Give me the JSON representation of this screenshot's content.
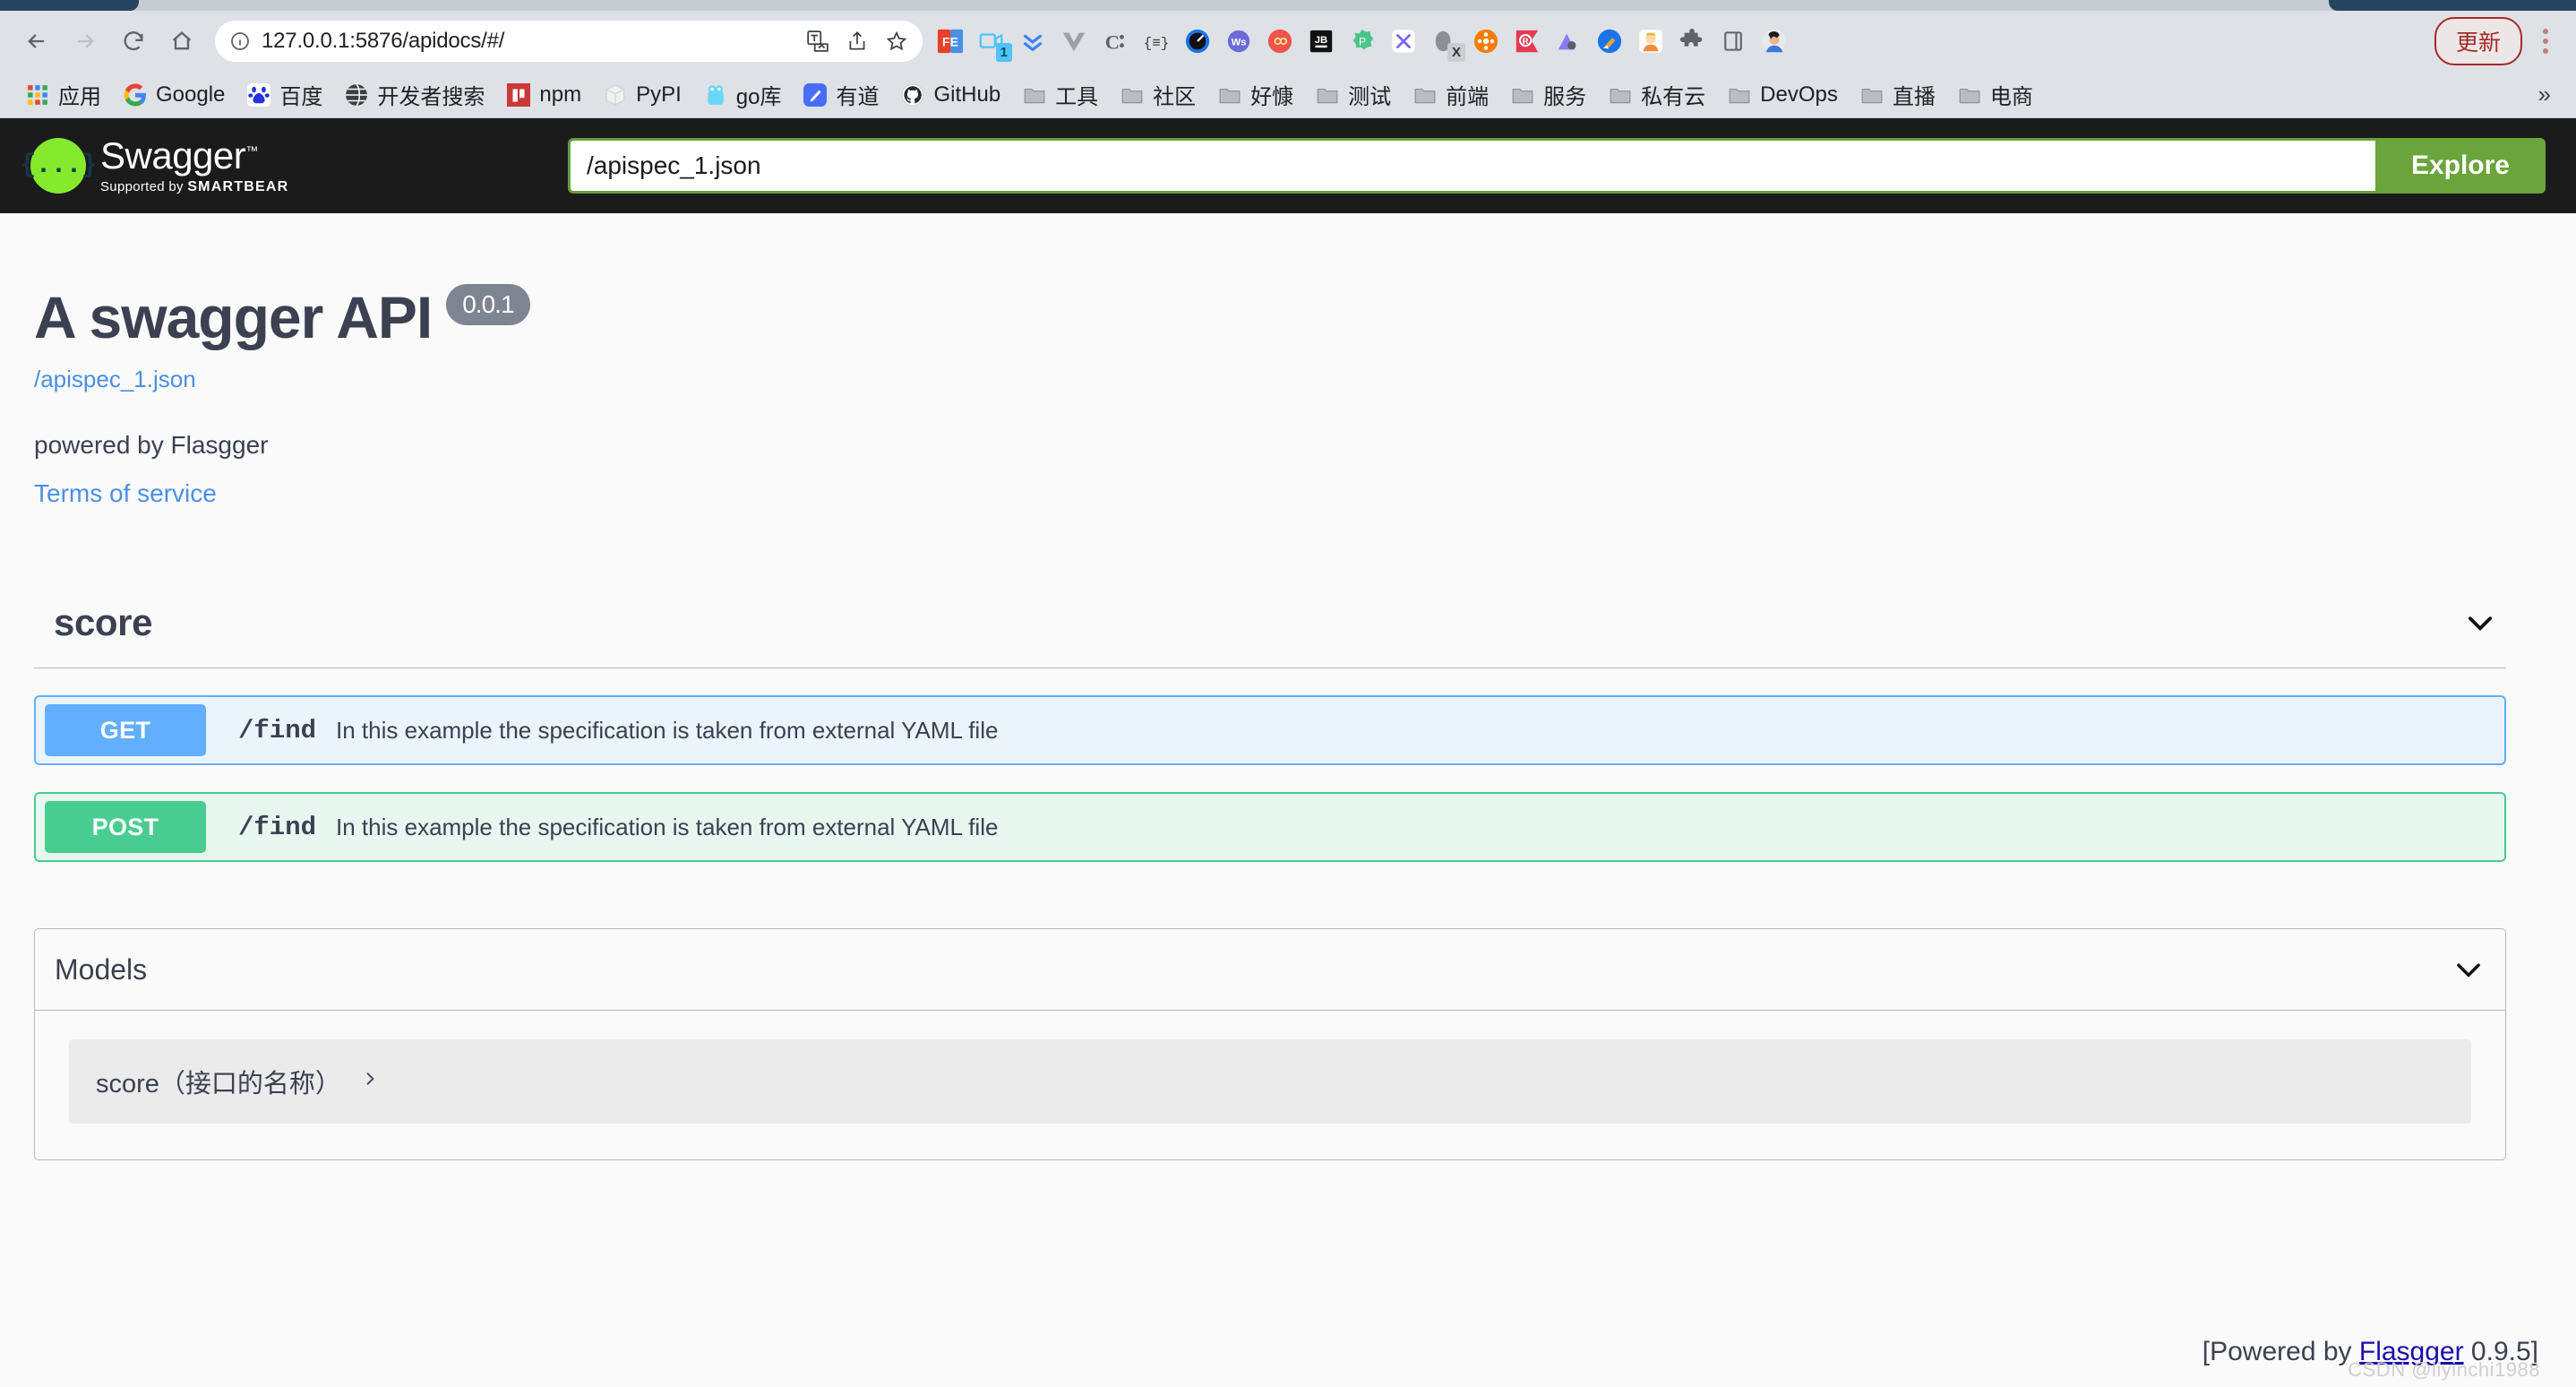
{
  "browser": {
    "nav": {
      "back": "back-arrow",
      "forward": "forward-arrow",
      "reload": "reload",
      "home": "home"
    },
    "omnibox": {
      "info_icon": "site-info-icon",
      "url_main": "127.0.0.1",
      "url_rest": ":5876/apidocs/#/",
      "url_full": "127.0.0.1:5876/apidocs/#/",
      "translate_icon": "translate-icon",
      "share_icon": "share-icon",
      "bookmark_icon": "bookmark-star-icon"
    },
    "extensions": [
      {
        "name": "fe-helper-extension",
        "label": "FE"
      },
      {
        "name": "screen-recorder-extension",
        "badge": "1"
      },
      {
        "name": "double-chevron-down-extension"
      },
      {
        "name": "vue-devtools-extension",
        "label": "V"
      },
      {
        "name": "c-colon-extension",
        "label": "C:"
      },
      {
        "name": "json-formatter-extension",
        "label": "{≡}"
      },
      {
        "name": "speed-dial-extension"
      },
      {
        "name": "wappalyzer-extension",
        "label": "Ws"
      },
      {
        "name": "infinity-extension"
      },
      {
        "name": "jetbrains-toolbox-extension",
        "label": "JB"
      },
      {
        "name": "postman-extension",
        "label": "P"
      },
      {
        "name": "xmind-extension",
        "label": "X"
      },
      {
        "name": "egg-extension",
        "badge": "X"
      },
      {
        "name": "hub-orange-extension"
      },
      {
        "name": "r-red-extension",
        "label": "R"
      },
      {
        "name": "mountain-purple-extension"
      },
      {
        "name": "broom-extension"
      },
      {
        "name": "avatar-yellow-extension"
      },
      {
        "name": "puzzle-extensions-icon"
      },
      {
        "name": "sidepanel-icon"
      },
      {
        "name": "profile-avatar"
      }
    ],
    "update_button": "更新",
    "kebab_menu": "browser-menu-icon",
    "bookmarks": [
      {
        "label": "应用",
        "icon": "apps-grid-icon"
      },
      {
        "label": "Google",
        "icon": "google-icon"
      },
      {
        "label": "百度",
        "icon": "baidu-icon"
      },
      {
        "label": "开发者搜索",
        "icon": "globe-icon"
      },
      {
        "label": "npm",
        "icon": "npm-icon"
      },
      {
        "label": "PyPI",
        "icon": "pypi-icon"
      },
      {
        "label": "go库",
        "icon": "golang-icon"
      },
      {
        "label": "有道",
        "icon": "youdao-icon"
      },
      {
        "label": "GitHub",
        "icon": "github-icon"
      },
      {
        "label": "工具",
        "icon": "folder-icon"
      },
      {
        "label": "社区",
        "icon": "folder-icon"
      },
      {
        "label": "好慷",
        "icon": "folder-icon"
      },
      {
        "label": "测试",
        "icon": "folder-icon"
      },
      {
        "label": "前端",
        "icon": "folder-icon"
      },
      {
        "label": "服务",
        "icon": "folder-icon"
      },
      {
        "label": "私有云",
        "icon": "folder-icon"
      },
      {
        "label": "DevOps",
        "icon": "folder-icon"
      },
      {
        "label": "直播",
        "icon": "folder-icon"
      },
      {
        "label": "电商",
        "icon": "folder-icon"
      }
    ],
    "bookmarks_overflow": "»"
  },
  "swagger": {
    "logo": {
      "glyph": "{...}",
      "title": "Swagger",
      "trademark": "™",
      "supported_prefix": "Supported by",
      "supported_brand": "SMARTBEAR"
    },
    "spec_input_value": "/apispec_1.json",
    "spec_input_placeholder": "/apispec_1.json",
    "explore_label": "Explore"
  },
  "info": {
    "title": "A swagger API",
    "version": "0.0.1",
    "spec_url": "/apispec_1.json",
    "description": "powered by Flasgger",
    "terms_label": "Terms of service"
  },
  "tags": [
    {
      "name": "score",
      "collapse_icon": "chevron-down-icon",
      "operations": [
        {
          "method": "GET",
          "path": "/find",
          "summary": "In this example the specification is taken from external YAML file",
          "color": "#61affe",
          "bg": "#ebf3fb"
        },
        {
          "method": "POST",
          "path": "/find",
          "summary": "In this example the specification is taken from external YAML file",
          "color": "#49cc90",
          "bg": "#e8f6f0"
        }
      ]
    }
  ],
  "models": {
    "title": "Models",
    "collapse_icon": "chevron-down-icon",
    "items": [
      {
        "name": "score（接口的名称）",
        "expand_icon": "chevron-right-icon"
      }
    ]
  },
  "footer": {
    "prefix": "[Powered by ",
    "link": "Flasgger",
    "suffix": " 0.9.5]",
    "watermark": "CSDN @liyinchi1988"
  },
  "colors": {
    "swagger_green": "#6ba43a",
    "logo_green": "#85ea2d",
    "get_blue": "#61affe",
    "post_green": "#49cc90",
    "text_dark": "#3b4151",
    "link_blue": "#4a90e2",
    "topbar_bg": "#1b1b1b"
  }
}
